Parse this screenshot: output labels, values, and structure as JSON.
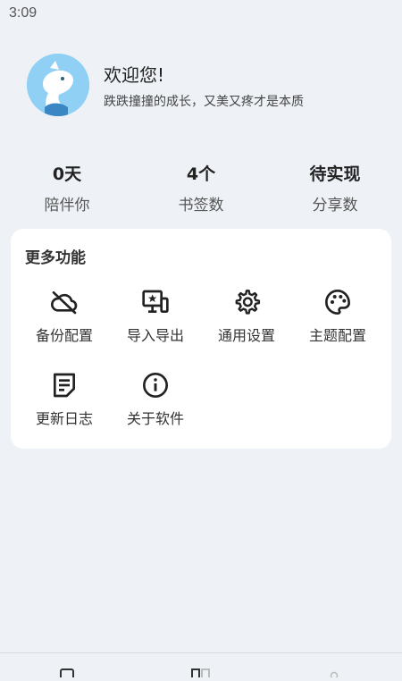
{
  "status_bar": {
    "time": "3:09"
  },
  "profile": {
    "welcome": "欢迎您!",
    "tagline": "跌跌撞撞的成长，又美又疼才是本质"
  },
  "stats": [
    {
      "value": "0天",
      "label": "陪伴你"
    },
    {
      "value": "4个",
      "label": "书签数"
    },
    {
      "value": "待实现",
      "label": "分享数"
    }
  ],
  "more": {
    "title": "更多功能",
    "items": [
      {
        "label": "备份配置",
        "icon": "cloud-off-icon"
      },
      {
        "label": "导入导出",
        "icon": "import-export-icon"
      },
      {
        "label": "通用设置",
        "icon": "gear-icon"
      },
      {
        "label": "主题配置",
        "icon": "palette-icon"
      },
      {
        "label": "更新日志",
        "icon": "note-icon"
      },
      {
        "label": "关于软件",
        "icon": "info-icon"
      }
    ]
  },
  "bottom_nav": {
    "items": [
      {
        "icon": "home-icon"
      },
      {
        "icon": "apps-icon"
      },
      {
        "icon": "profile-icon"
      }
    ]
  }
}
